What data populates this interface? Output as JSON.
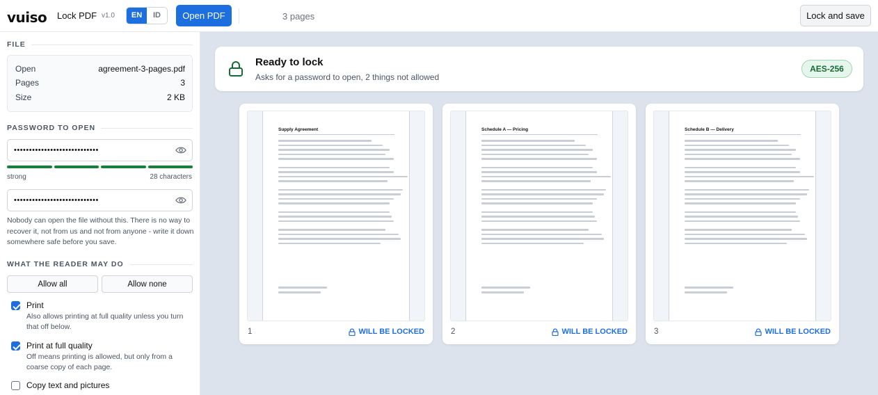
{
  "header": {
    "logo": "vuiso",
    "app_name": "Lock PDF",
    "version": "v1.0",
    "languages": [
      "EN",
      "ID"
    ],
    "active_language": "EN",
    "open_label": "Open PDF",
    "page_count_label": "3 pages",
    "save_label": "Lock and save"
  },
  "sidebar": {
    "file": {
      "title": "FILE",
      "rows": [
        {
          "label": "Open",
          "value": "agreement-3-pages.pdf"
        },
        {
          "label": "Pages",
          "value": "3"
        },
        {
          "label": "Size",
          "value": "2 KB"
        }
      ]
    },
    "password": {
      "title": "PASSWORD TO OPEN",
      "masked": "••••••••••••••••••••••••••••",
      "confirm_masked": "••••••••••••••••••••••••••••",
      "strength_label": "strong",
      "strength_segments": 4,
      "strength_filled": 4,
      "char_count": "28 characters",
      "warning": "Nobody can open the file without this. There is no way to recover it, not from us and not from anyone - write it down somewhere safe before you save."
    },
    "permissions": {
      "title": "WHAT THE READER MAY DO",
      "allow_all": "Allow all",
      "allow_none": "Allow none",
      "items": [
        {
          "label": "Print",
          "checked": true,
          "desc": "Also allows printing at full quality unless you turn that off below."
        },
        {
          "label": "Print at full quality",
          "checked": true,
          "desc": "Off means printing is allowed, but only from a coarse copy of each page."
        },
        {
          "label": "Copy text and pictures",
          "checked": false,
          "desc": ""
        }
      ]
    }
  },
  "status": {
    "title": "Ready to lock",
    "subtitle": "Asks for a password to open, 2 things not allowed",
    "badge": "AES-256",
    "color_success": "#146c33"
  },
  "pages": [
    {
      "number": "1",
      "title": "Supply Agreement",
      "lock_label": "WILL BE LOCKED"
    },
    {
      "number": "2",
      "title": "Schedule A — Pricing",
      "lock_label": "WILL BE LOCKED"
    },
    {
      "number": "3",
      "title": "Schedule B — Delivery",
      "lock_label": "WILL BE LOCKED"
    }
  ],
  "colors": {
    "accent": "#1d6fe0",
    "strength": "#1a7f3c",
    "canvas": "#dde3ec"
  }
}
